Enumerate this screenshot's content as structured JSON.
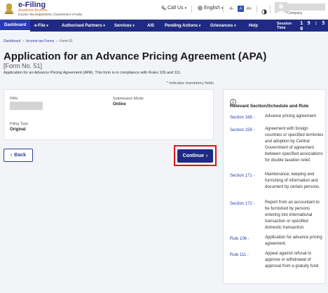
{
  "header": {
    "brand_name": "e-Filing",
    "brand_sub": "Anywhere Anytime",
    "brand_dept": "Income Tax Department, Government of India",
    "call_us": "Call Us",
    "language": "English",
    "font_small": "A-",
    "font_normal": "A",
    "font_large": "A+",
    "company": "Company"
  },
  "nav": {
    "items": [
      {
        "label": "Dashboard"
      },
      {
        "label": "e-File"
      },
      {
        "label": "Authorised Partners"
      },
      {
        "label": "Services"
      },
      {
        "label": "AIS"
      },
      {
        "label": "Pending Actions"
      },
      {
        "label": "Grievances"
      },
      {
        "label": "Help"
      }
    ],
    "session_label": "Session Time",
    "session_time": "1 9 : 5 0"
  },
  "breadcrumb": [
    "Dashboard",
    "Income-tax Forms",
    "Form 51"
  ],
  "page": {
    "title": "Application for an Advance Pricing Agreement (APA)",
    "form_no": "[Form No. 51]",
    "description": "Application for an Advance Pricing Agreement (APA). This form is in compliance with Rules 106 and 111.",
    "mandatory_note": "* Indicates mandatory fields"
  },
  "form": {
    "pan_label": "PAN",
    "submission_mode_label": "Submission Mode",
    "submission_mode_value": "Online",
    "filing_type_label": "Filing Type",
    "filing_type_value": "Original"
  },
  "buttons": {
    "back": "Back",
    "continue": "Continue"
  },
  "panel": {
    "title": "Relevant Section/Schedule and Rule",
    "rules": [
      {
        "section": "Section 168 -",
        "text": "Advance pricing agreement"
      },
      {
        "section": "Section 159 -",
        "text": "Agreement with foreign countries or specified territories and adoption by Central Government of agreement between specified associations for double taxation relief."
      },
      {
        "section": "Section 171 -",
        "text": "Maintenance, keeping and furnishing of information and document by certain persons."
      },
      {
        "section": "Section 172 -",
        "text": "Report from an accountant to be furnished by persons entering into international transaction or specified domestic transaction."
      },
      {
        "section": "Rule 106 -",
        "text": "Application for advance pricing agreement."
      },
      {
        "section": "Rule 111 -",
        "text": "Appeal against refusal to approve or withdrawal of approval from a gratuity fund"
      }
    ]
  },
  "colors": {
    "nav_bg": "#1f2b82",
    "link": "#2c3f9e",
    "highlight": "#e1121b"
  }
}
